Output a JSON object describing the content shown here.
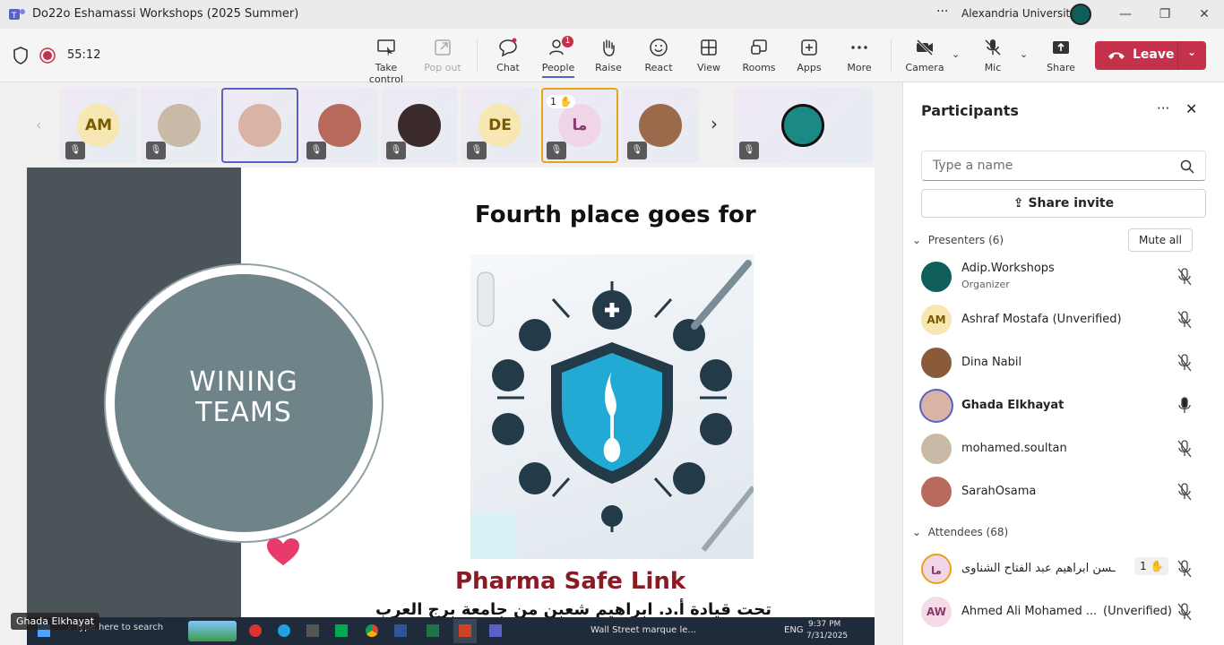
{
  "window": {
    "title": "Do22o Eshamassi Workshops (2025 Summer)",
    "org": "Alexandria University",
    "more": "···"
  },
  "meeting": {
    "timer": "55:12"
  },
  "toolbar": {
    "items": [
      {
        "label": "Take control"
      },
      {
        "label": "Pop out"
      },
      {
        "label": "Chat"
      },
      {
        "label": "People",
        "badge": "1"
      },
      {
        "label": "Raise"
      },
      {
        "label": "React"
      },
      {
        "label": "View"
      },
      {
        "label": "Rooms"
      },
      {
        "label": "Apps"
      },
      {
        "label": "More"
      },
      {
        "label": "Camera"
      },
      {
        "label": "Mic"
      },
      {
        "label": "Share"
      }
    ],
    "leave": "Leave"
  },
  "strip": {
    "tiles": [
      {
        "initials": "AM",
        "bg": "#f7e7b2",
        "fg": "#7a5a00"
      },
      {
        "initials": "",
        "bg": "#c9b9a7"
      },
      {
        "initials": "",
        "bg": "#d9b4a6"
      },
      {
        "initials": "",
        "bg": "#b76a5c"
      },
      {
        "initials": "",
        "bg": "#3a2a2a"
      },
      {
        "initials": "DE",
        "bg": "#f7e7b2",
        "fg": "#7a5a00"
      },
      {
        "initials": "ما",
        "bg": "#f0d5e6",
        "fg": "#8a3a6a",
        "hand": "1"
      },
      {
        "initials": "",
        "bg": "#9a6a4a"
      },
      {
        "initials": "",
        "bg": "#1c8a84"
      }
    ]
  },
  "slide": {
    "left_text_1": "WINING",
    "left_text_2": "TEAMS",
    "title": "Fourth place goes for",
    "team": "Pharma Safe Link",
    "subtitle": "تحت قيادة أ.د. ابراهيم شعبن من جامعة برج العرب التكنولوجية"
  },
  "taskbar": {
    "search": "Type here to search",
    "news": "Wall Street marque le...",
    "lang": "ENG",
    "time": "9:37 PM",
    "date": "7/31/2025"
  },
  "presenter_tag": "Ghada Elkhayat",
  "panel": {
    "title": "Participants",
    "search_placeholder": "Type a name",
    "invite": "Share invite",
    "presenters_label": "Presenters (6)",
    "mute_all": "Mute all",
    "attendees_label": "Attendees (68)",
    "presenters": [
      {
        "name": "Adip.Workshops",
        "role": "Organizer",
        "initials": "",
        "bg": "#0f5e5a"
      },
      {
        "name": "Ashraf Mostafa (Unverified)",
        "initials": "AM",
        "bg": "#f7e7b2",
        "fg": "#7a5a00"
      },
      {
        "name": "Dina Nabil",
        "initials": "",
        "bg": "#8a5a3a"
      },
      {
        "name": "Ghada Elkhayat",
        "initials": "",
        "bg": "#d9b4a6"
      },
      {
        "name": "mohamed.soultan",
        "initials": "",
        "bg": "#c9b9a7"
      },
      {
        "name": "SarahOsama",
        "initials": "",
        "bg": "#b76a5c"
      }
    ],
    "attendees": [
      {
        "name": "ـسن ابراهيم عبد الفتاح الشناوى",
        "initials": "ما",
        "bg": "#f0d5e6",
        "fg": "#8a3a6a",
        "hand": "1"
      },
      {
        "name": "Ahmed Ali Mohamed ...",
        "suffix": "(Unverified)",
        "initials": "AW",
        "bg": "#f3dbe8",
        "fg": "#8a3a6a"
      }
    ]
  }
}
